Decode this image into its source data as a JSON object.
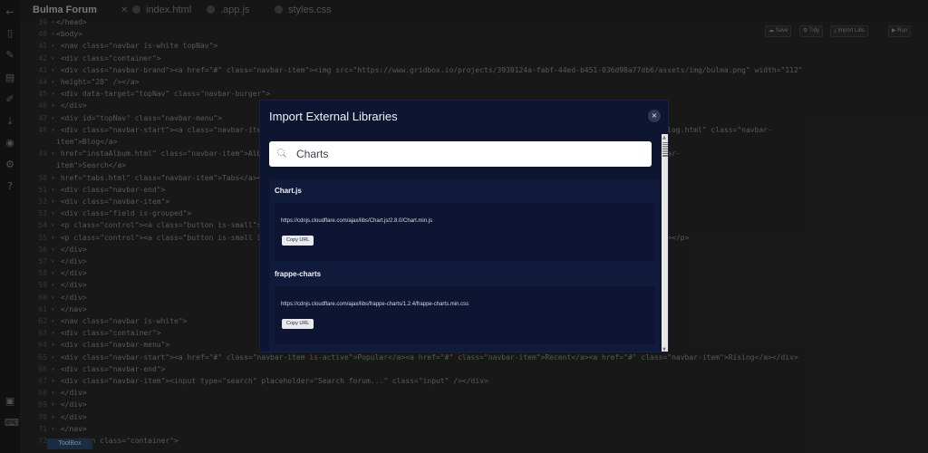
{
  "editor": {
    "tabs": [
      {
        "label": "Bulma Forum",
        "active": true
      },
      {
        "label": "index.html",
        "active": false
      },
      {
        "label": ".app.js",
        "active": false
      },
      {
        "label": "styles.css",
        "active": false
      }
    ],
    "actions": {
      "save": "Save",
      "tidy": "Tidy",
      "import": "Import Libs",
      "run": "Run"
    },
    "toolbox_label": "ToolBox",
    "lines": [
      {
        "n": "39",
        "t": "</head>"
      },
      {
        "n": "40",
        "t": "<body>"
      },
      {
        "n": "41",
        "t": "    <nav class=\"navbar is-white topNav\">"
      },
      {
        "n": "42",
        "t": "        <div class=\"container\">"
      },
      {
        "n": "43",
        "t": "            <div class=\"navbar-brand\"><a href=\"#\" class=\"navbar-item\"><img src=\"https://www.gridbox.io/projects/3930124a-fabf-44ed-b451-036d98a77db6/assets/img/bulma.png\" width=\"112\""
      },
      {
        "n": "44",
        "t": "                        height=\"28\" /></a>"
      },
      {
        "n": "45",
        "t": "                <div data-target=\"topNav\" class=\"navbar-burger\">"
      },
      {
        "n": "46",
        "t": "            </div>"
      },
      {
        "n": "47",
        "t": "            <div id=\"topNav\" class=\"navbar-menu\">"
      },
      {
        "n": "48",
        "t": "                <div class=\"navbar-start\"><a class=\"navbar-item\" href=\"cover.html\">Home</a><a class=\"navbar-item\" href=\"landing.html\">Landing</a><a href=\"blog.html\" class=\"navbar-"
      },
      {
        "n": "",
        "t": "item\">Blog</a>"
      },
      {
        "n": "49",
        "t": "                        href=\"instaAlbum.html\" class=\"navbar-item\">Album</a><a class=\"navbar-item\" href=\"profile.html\">Profile</a><a href=\"search.html\" class=\"navbar-"
      },
      {
        "n": "",
        "t": "item\">Search</a>"
      },
      {
        "n": "50",
        "t": "                        href=\"tabs.html\" class=\"navbar-item\">Tabs</a></div>"
      },
      {
        "n": "51",
        "t": "                <div class=\"navbar-end\">"
      },
      {
        "n": "52",
        "t": "                    <div class=\"navbar-item\">"
      },
      {
        "n": "53",
        "t": "                        <div class=\"field is-grouped\">"
      },
      {
        "n": "54",
        "t": "                            <p class=\"control\"><a class=\"button is-small\"><span class=\"icon\"><i class=\"fa fa-user-plus\"></i></span><span> Register </span></a></p>"
      },
      {
        "n": "55",
        "t": "                            <p class=\"control\"><a class=\"button is-small is-info is-outlined\"><span class=\"icon\"><i class=\"fa fa-user\"></i></span><span>Login</span></a></p>"
      },
      {
        "n": "56",
        "t": "                        </div>"
      },
      {
        "n": "57",
        "t": "                    </div>"
      },
      {
        "n": "58",
        "t": "                </div>"
      },
      {
        "n": "59",
        "t": "            </div>"
      },
      {
        "n": "60",
        "t": "        </div>"
      },
      {
        "n": "61",
        "t": "    </nav>"
      },
      {
        "n": "62",
        "t": "    <nav class=\"navbar is-white\">"
      },
      {
        "n": "63",
        "t": "        <div class=\"container\">"
      },
      {
        "n": "64",
        "t": "            <div class=\"navbar-menu\">"
      },
      {
        "n": "65",
        "t": "                <div class=\"navbar-start\"><a href=\"#\" class=\"navbar-item is-active\">Popular</a><a href=\"#\" class=\"navbar-item\">Recent</a><a href=\"#\" class=\"navbar-item\">Rising</a></div>"
      },
      {
        "n": "66",
        "t": "                <div class=\"navbar-end\">"
      },
      {
        "n": "67",
        "t": "                    <div class=\"navbar-item\"><input type=\"search\" placeholder=\"Search forum...\" class=\"input\" /></div>"
      },
      {
        "n": "68",
        "t": "                </div>"
      },
      {
        "n": "69",
        "t": "            </div>"
      },
      {
        "n": "70",
        "t": "        </div>"
      },
      {
        "n": "71",
        "t": "    </nav>"
      },
      {
        "n": "72",
        "t": "    <section class=\"container\">"
      }
    ]
  },
  "modal": {
    "title": "Import External Libraries",
    "close": "×",
    "search_value": "Charts",
    "libraries": [
      {
        "name": "Chart.js",
        "url": "https://cdnjs.cloudflare.com/ajax/libs/Chart.js/2.8.0/Chart.min.js",
        "button": "Copy URL"
      },
      {
        "name": "frappe-charts",
        "url": "https://cdnjs.cloudflare.com/ajax/libs/frappe-charts/1.2.4/frappe-charts.min.css",
        "button": "Copy URL"
      }
    ]
  }
}
